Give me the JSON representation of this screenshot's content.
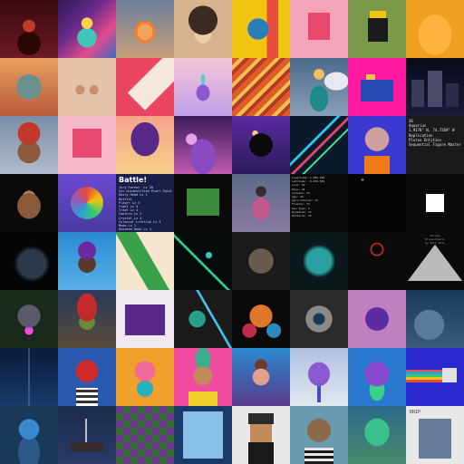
{
  "gallery": {
    "battle_tile": {
      "title": "Battle!",
      "lines": [
        "Jury Forest  Lv 20",
        "Giv Unidentified Pixel Paint Lv. 4",
        "Hairy Head Lv 1",
        "Battle1",
        "Player Lv 3",
        "Fight Lv 4",
        "Trash Lv 4",
        "Capture Lv 2",
        "Crystal Lv 4",
        "Colonial Lifeline Lv 3",
        "Mode Lv 1",
        "Knocked Down Lv 4"
      ]
    },
    "info_tile": {
      "lines": [
        "36",
        "Aquarius",
        "1.9178° N, 74.7269° W",
        "Replication",
        "Plutus Entities",
        "Sequential Figure Master"
      ]
    },
    "coord_tile": {
      "lines": [
        "Longitude: 1.385.498",
        "Latitude: -0.236.839",
        "Line: 91",
        "Rows: 24",
        "Columns: 24",
        "Age: 44",
        "Agricultural: 33",
        "Floater: 33",
        "Geo Type: 6",
        "Dynamism: 15",
        "Patterns: 15"
      ]
    },
    "pyramid_tile": {
      "caption": "Chroma\nRinascimento\nby Kalo Dall"
    },
    "drip_tile": {
      "label": "DRIP"
    },
    "colors": {
      "background": "#000000",
      "battle_bg": "#1a1f4a"
    }
  }
}
